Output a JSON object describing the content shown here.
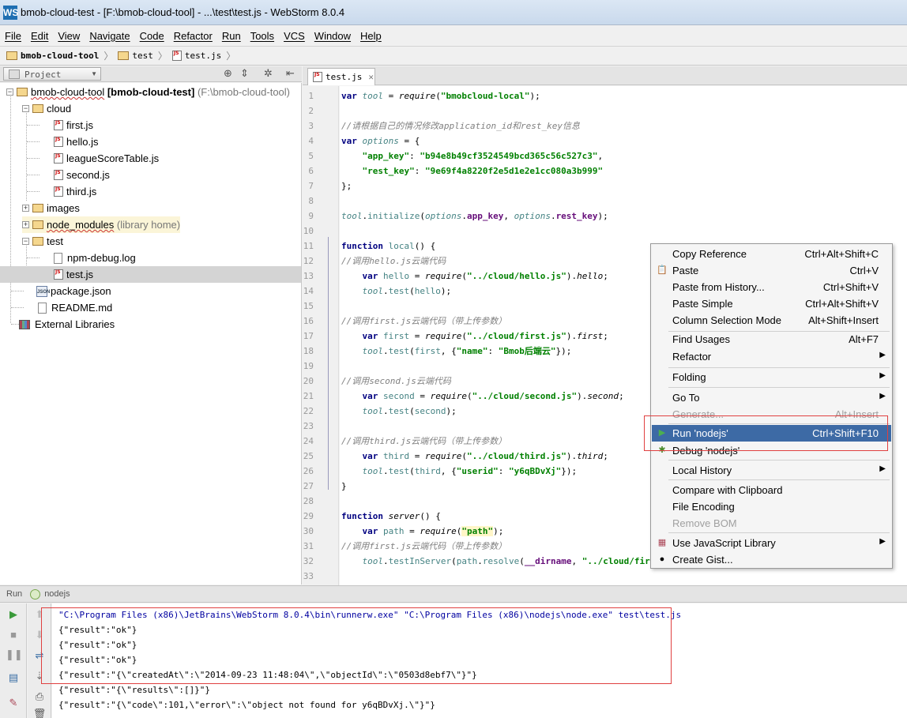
{
  "window": {
    "title": "bmob-cloud-test - [F:\\bmob-cloud-tool] - ...\\test\\test.js - WebStorm 8.0.4",
    "app_icon": "WS"
  },
  "menubar": [
    "File",
    "Edit",
    "View",
    "Navigate",
    "Code",
    "Refactor",
    "Run",
    "Tools",
    "VCS",
    "Window",
    "Help"
  ],
  "breadcrumb": [
    "bmob-cloud-tool",
    "test",
    "test.js"
  ],
  "project_panel": {
    "view_label": "Project",
    "tree": [
      {
        "label": "bmob-cloud-tool",
        "bold_suffix": "[bmob-cloud-test]",
        "path_suffix": "(F:\\bmob-cloud-tool)"
      },
      {
        "label": "cloud"
      },
      {
        "label": "first.js"
      },
      {
        "label": "hello.js"
      },
      {
        "label": "leagueScoreTable.js"
      },
      {
        "label": "second.js"
      },
      {
        "label": "third.js"
      },
      {
        "label": "images"
      },
      {
        "label": "node_modules",
        "suffix": "(library home)"
      },
      {
        "label": "test"
      },
      {
        "label": "npm-debug.log"
      },
      {
        "label": "test.js"
      },
      {
        "label": "package.json"
      },
      {
        "label": "README.md"
      },
      {
        "label": "External Libraries"
      }
    ]
  },
  "editor": {
    "tab_label": "test.js",
    "line_numbers": [
      "1",
      "2",
      "3",
      "4",
      "5",
      "6",
      "7",
      "8",
      "9",
      "10",
      "11",
      "12",
      "13",
      "14",
      "15",
      "16",
      "17",
      "18",
      "19",
      "20",
      "21",
      "22",
      "23",
      "24",
      "25",
      "26",
      "27",
      "28",
      "29",
      "30",
      "31",
      "32",
      "33"
    ]
  },
  "context_menu": {
    "items": [
      {
        "label": "Copy Reference",
        "shortcut": "Ctrl+Alt+Shift+C"
      },
      {
        "label": "Paste",
        "shortcut": "Ctrl+V"
      },
      {
        "label": "Paste from History...",
        "shortcut": "Ctrl+Shift+V"
      },
      {
        "label": "Paste Simple",
        "shortcut": "Ctrl+Alt+Shift+V"
      },
      {
        "label": "Column Selection Mode",
        "shortcut": "Alt+Shift+Insert"
      },
      {
        "label": "Find Usages",
        "shortcut": "Alt+F7"
      },
      {
        "label": "Refactor",
        "shortcut": ""
      },
      {
        "label": "Folding",
        "shortcut": ""
      },
      {
        "label": "Go To",
        "shortcut": ""
      },
      {
        "label": "Generate...",
        "shortcut": "Alt+Insert"
      },
      {
        "label": "Run 'nodejs'",
        "shortcut": "Ctrl+Shift+F10"
      },
      {
        "label": "Debug 'nodejs'",
        "shortcut": ""
      },
      {
        "label": "Local History",
        "shortcut": ""
      },
      {
        "label": "Compare with Clipboard",
        "shortcut": ""
      },
      {
        "label": "File Encoding",
        "shortcut": ""
      },
      {
        "label": "Remove BOM",
        "shortcut": ""
      },
      {
        "label": "Use JavaScript Library",
        "shortcut": ""
      },
      {
        "label": "Create Gist...",
        "shortcut": ""
      }
    ]
  },
  "run_panel": {
    "title": "Run",
    "config": "nodejs",
    "console": [
      "\"C:\\Program Files (x86)\\JetBrains\\WebStorm 8.0.4\\bin\\runnerw.exe\" \"C:\\Program Files (x86)\\nodejs\\node.exe\" test\\test.js",
      "{\"result\":\"ok\"}",
      "{\"result\":\"ok\"}",
      "{\"result\":\"ok\"}",
      "{\"result\":\"{\\\"createdAt\\\":\\\"2014-09-23 11:48:04\\\",\\\"objectId\\\":\\\"0503d8ebf7\\\"}\"}",
      "{\"result\":\"{\\\"results\\\":[]}\"}",
      "{\"result\":\"{\\\"code\\\":101,\\\"error\\\":\\\"object not found for y6qBDvXj.\\\"}\"}"
    ]
  },
  "colors": {
    "menu_highlight": "#3d6aa5",
    "annotation_red": "#e04040"
  }
}
